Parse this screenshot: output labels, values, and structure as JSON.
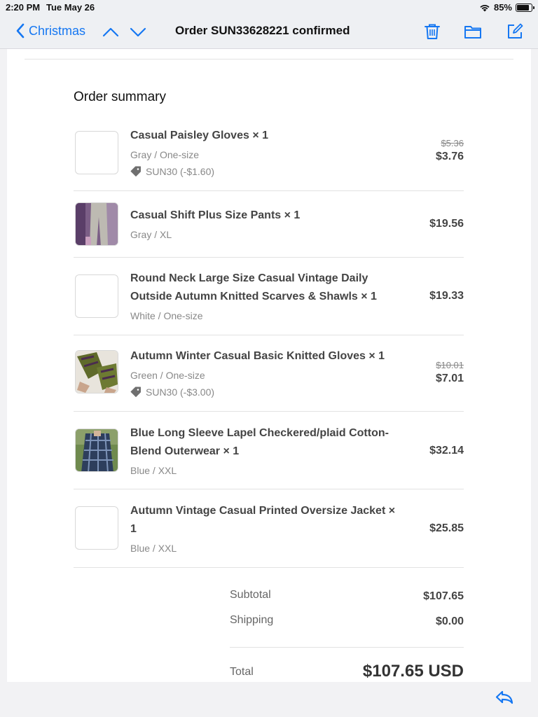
{
  "status": {
    "time": "2:20 PM",
    "date": "Tue May 26",
    "battery": "85%",
    "battery_level": 0.85
  },
  "nav": {
    "back_label": "Christmas",
    "title": "Order SUN33628221 confirmed",
    "icons": [
      "chevron-left-icon",
      "chevron-up-icon",
      "chevron-down-icon",
      "trash-icon",
      "folder-icon",
      "compose-icon"
    ]
  },
  "summary": {
    "title": "Order summary",
    "items": [
      {
        "name": "Casual Paisley Gloves × 1",
        "variant": "Gray / One-size",
        "discount": "SUN30 (-$1.60)",
        "original_price": "$5.36",
        "price": "$3.76"
      },
      {
        "name": "Casual Shift Plus Size Pants × 1",
        "variant": "Gray / XL",
        "price": "$19.56"
      },
      {
        "name": "Round Neck Large Size Casual Vintage Daily Outside Autumn Knitted Scarves & Shawls × 1",
        "variant": "White / One-size",
        "price": "$19.33"
      },
      {
        "name": "Autumn Winter Casual Basic Knitted Gloves × 1",
        "variant": "Green / One-size",
        "discount": "SUN30 (-$3.00)",
        "original_price": "$10.01",
        "price": "$7.01"
      },
      {
        "name": "Blue Long Sleeve Lapel Checkered/plaid Cotton-Blend Outerwear × 1",
        "variant": "Blue / XXL",
        "price": "$32.14"
      },
      {
        "name": "Autumn Vintage Casual Printed Oversize Jacket × 1",
        "variant": "Blue / XXL",
        "price": "$25.85"
      }
    ]
  },
  "totals": {
    "subtotal_label": "Subtotal",
    "subtotal": "$107.65",
    "shipping_label": "Shipping",
    "shipping": "$0.00",
    "total_label": "Total",
    "total": "$107.65 USD"
  },
  "colors": {
    "accent": "#1577f2",
    "text_primary": "#444444",
    "text_secondary": "#888888"
  }
}
